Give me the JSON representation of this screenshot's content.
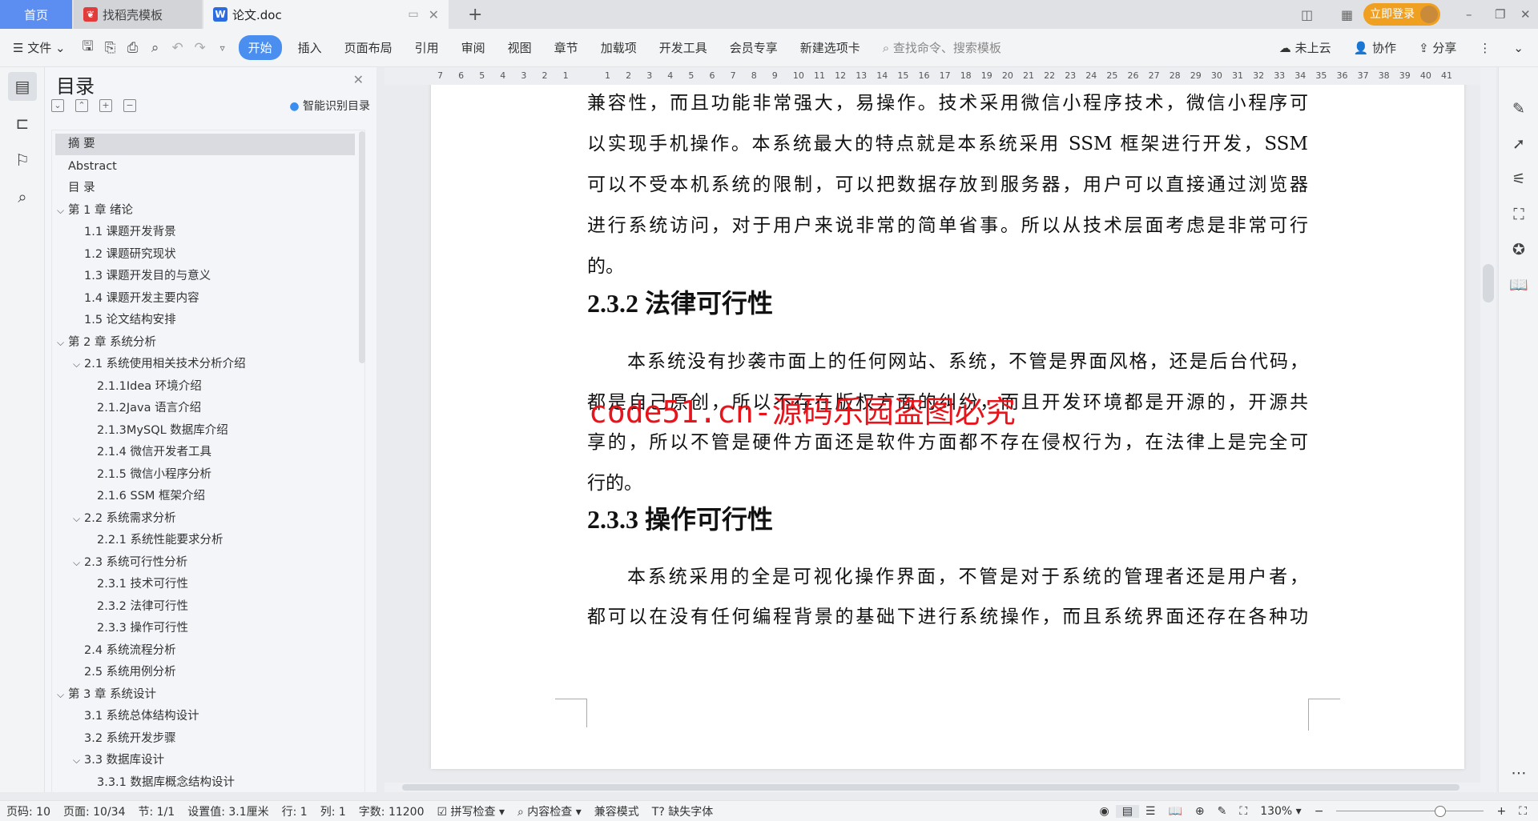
{
  "tabs": {
    "home": "首页",
    "template": "找稻壳模板",
    "doc": "论文.doc",
    "new_tab": "+"
  },
  "window": {
    "login": "立即登录",
    "minimize": "–",
    "restore": "❐",
    "close": "✕"
  },
  "toolbar": {
    "file": "文件",
    "menus": [
      "开始",
      "插入",
      "页面布局",
      "引用",
      "审阅",
      "视图",
      "章节",
      "加载项",
      "开发工具",
      "会员专享",
      "新建选项卡"
    ],
    "search_placeholder": "查找命令、搜索模板",
    "cloud": "未上云",
    "collab": "协作",
    "share": "分享"
  },
  "ruler": {
    "left_ticks": [
      "7",
      "6",
      "5",
      "4",
      "3",
      "2",
      "1"
    ],
    "right_ticks": [
      "1",
      "2",
      "3",
      "4",
      "5",
      "6",
      "7",
      "8",
      "9",
      "10",
      "11",
      "12",
      "13",
      "14",
      "15",
      "16",
      "17",
      "18",
      "19",
      "20",
      "21",
      "22",
      "23",
      "24",
      "25",
      "26",
      "27",
      "28",
      "29",
      "30",
      "31",
      "32",
      "33",
      "34",
      "35",
      "36",
      "37",
      "38",
      "39",
      "40",
      "41"
    ]
  },
  "toc": {
    "title": "目录",
    "smart": "智能识别目录",
    "items": [
      {
        "label": "摘  要",
        "level": 0,
        "selected": true
      },
      {
        "label": "Abstract",
        "level": 0
      },
      {
        "label": "目  录",
        "level": 0
      },
      {
        "label": "第 1 章   绪论",
        "level": 0,
        "expanded": true
      },
      {
        "label": "1.1 课题开发背景",
        "level": 1
      },
      {
        "label": "1.2 课题研究现状",
        "level": 1
      },
      {
        "label": "1.3 课题开发目的与意义",
        "level": 1
      },
      {
        "label": "1.4 课题开发主要内容",
        "level": 1
      },
      {
        "label": "1.5 论文结构安排",
        "level": 1
      },
      {
        "label": "第 2 章  系统分析",
        "level": 0,
        "expanded": true
      },
      {
        "label": "2.1 系统使用相关技术分析介绍",
        "level": 1,
        "expanded": true
      },
      {
        "label": "2.1.1Idea 环境介绍",
        "level": 2
      },
      {
        "label": "2.1.2Java 语言介绍",
        "level": 2
      },
      {
        "label": " 2.1.3MySQL 数据库介绍",
        "level": 2
      },
      {
        "label": "2.1.4 微信开发者工具",
        "level": 2
      },
      {
        "label": "2.1.5 微信小程序分析",
        "level": 2
      },
      {
        "label": "2.1.6 SSM 框架介绍",
        "level": 2
      },
      {
        "label": "2.2 系统需求分析",
        "level": 1,
        "expanded": true
      },
      {
        "label": "2.2.1 系统性能要求分析",
        "level": 2
      },
      {
        "label": "2.3 系统可行性分析",
        "level": 1,
        "expanded": true
      },
      {
        "label": "2.3.1 技术可行性",
        "level": 2
      },
      {
        "label": "2.3.2 法律可行性",
        "level": 2
      },
      {
        "label": "2.3.3 操作可行性",
        "level": 2
      },
      {
        "label": "2.4 系统流程分析",
        "level": 1
      },
      {
        "label": "2.5 系统用例分析",
        "level": 1
      },
      {
        "label": "第 3 章  系统设计",
        "level": 0,
        "expanded": true
      },
      {
        "label": "3.1 系统总体结构设计",
        "level": 1
      },
      {
        "label": "3.2 系统开发步骤",
        "level": 1
      },
      {
        "label": "3.3 数据库设计",
        "level": 1,
        "expanded": true
      },
      {
        "label": "3.3.1 数据库概念结构设计",
        "level": 2
      }
    ]
  },
  "document": {
    "p1": [
      "兼容性，而且功能非常强大，易操作。技术采用微信小程序技术，微信小程序可",
      "以实现手机操作。本系统最大的特点就是本系统采用 SSM 框架进行开发，SSM",
      "可以不受本机系统的限制，可以把数据存放到服务器，用户可以直接通过浏览器",
      "进行系统访问，对于用户来说非常的简单省事。所以从技术层面考虑是非常可行",
      "的。"
    ],
    "h232": "2.3.2 法律可行性",
    "p2": [
      "本系统没有抄袭市面上的任何网站、系统，不管是界面风格，还是后台代码，",
      "都是自己原创，所以不存在版权方面的纠纷，而且开发环境都是开源的，开源共",
      "享的，所以不管是硬件方面还是软件方面都不存在侵权行为，在法律上是完全可",
      "行的。"
    ],
    "h233": "2.3.3 操作可行性",
    "p3": [
      "本系统采用的全是可视化操作界面，不管是对于系统的管理者还是用户者，",
      "都可以在没有任何编程背景的基础下进行系统操作，而且系统界面还存在各种功"
    ],
    "watermark": "code51.cn-源码乐园盗图必究"
  },
  "status": {
    "page_no": "页码: 10",
    "pages": "页面: 10/34",
    "section": "节: 1/1",
    "setting": "设置值: 3.1厘米",
    "row": "行: 1",
    "col": "列: 1",
    "words": "字数: 11200",
    "spell": "拼写检查",
    "content": "内容检查",
    "compat": "兼容模式",
    "font_missing": "缺失字体",
    "zoom": "130%",
    "zoom_level": 130
  },
  "colors": {
    "accent": "#4a8ff0",
    "login": "#f0a020",
    "watermark": "#e8141b"
  }
}
